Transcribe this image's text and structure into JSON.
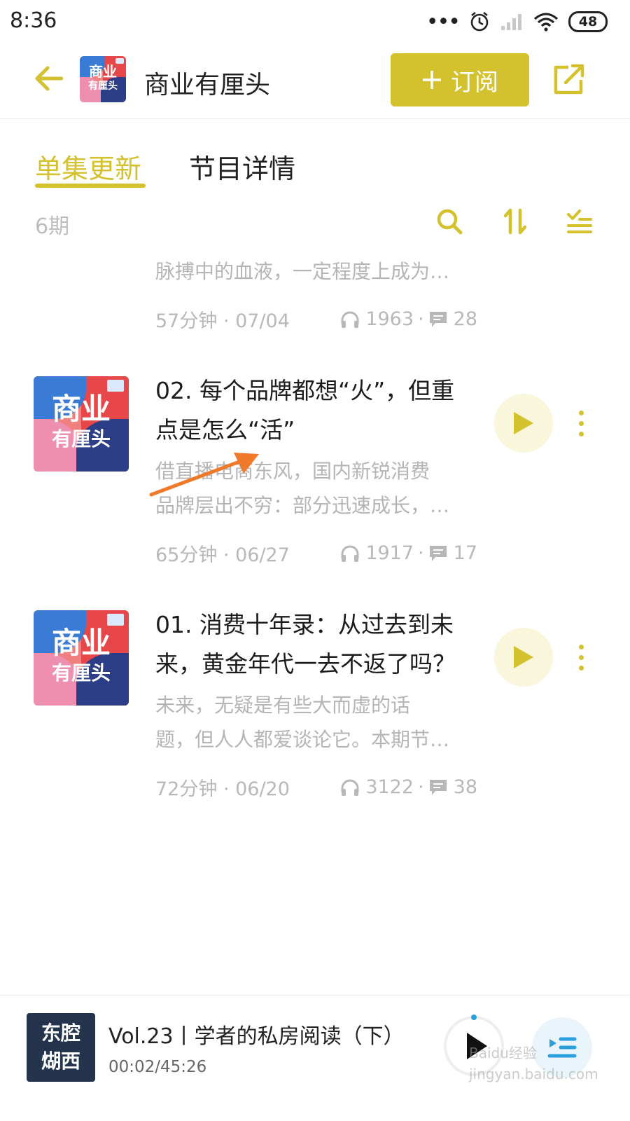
{
  "status": {
    "time": "8:36",
    "battery": "48"
  },
  "header": {
    "title": "商业有厘头",
    "subscribe_label": "订阅",
    "cover_text": [
      "商业",
      "有厘头"
    ]
  },
  "tabs": [
    {
      "label": "单集更新",
      "active": true
    },
    {
      "label": "节目详情",
      "active": false
    }
  ],
  "episode_count": "6期",
  "partial_episode": {
    "snippet_line": "脉搏中的血液，一定程度上成为…",
    "duration_date": "57分钟 · 07/04",
    "plays": "1963",
    "comments": "28"
  },
  "episodes": [
    {
      "title_lines": [
        "02. 每个品牌都想“火”，但重",
        "点是怎么“活”"
      ],
      "snippet_lines": [
        "借直播电商东风，国内新锐消费",
        "品牌层出不穷：部分迅速成长，…"
      ],
      "duration_date": "65分钟 · 06/27",
      "plays": "1917",
      "comments": "17"
    },
    {
      "title_lines": [
        "01. 消费十年录：从过去到未",
        "来，黄金年代一去不返了吗？"
      ],
      "snippet_lines": [
        "未来，无疑是有些大而虚的话",
        "题，但人人都爱谈论它。本期节…"
      ],
      "duration_date": "72分钟 · 06/20",
      "plays": "3122",
      "comments": "38"
    }
  ],
  "player": {
    "cover_lines": [
      "东腔",
      "煳西"
    ],
    "title": "Vol.23丨学者的私房阅读（下）",
    "time": "00:02/45:26"
  },
  "colors": {
    "accent": "#d4c12e",
    "annotation_arrow": "#f07a2a",
    "muted_text": "#b5b5b5"
  },
  "watermark": "Baidu经验 jingyan.baidu.com"
}
